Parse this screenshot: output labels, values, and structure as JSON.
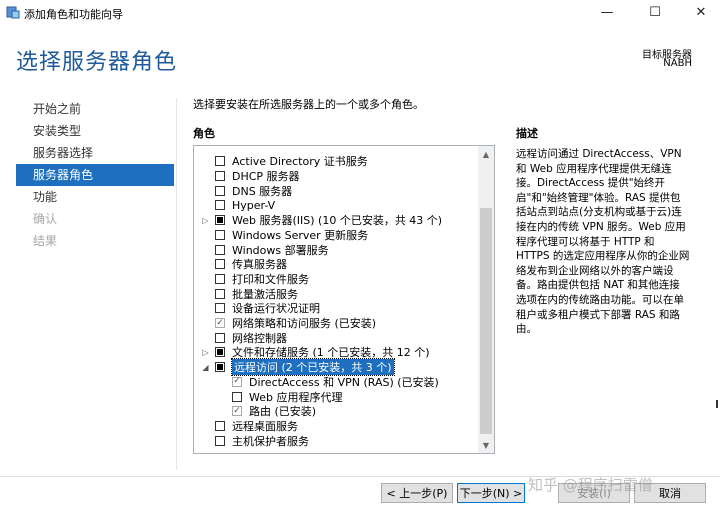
{
  "window": {
    "title": "添加角色和功能向导",
    "controls": {
      "minimize": "—",
      "maximize": "☐",
      "close": "✕"
    }
  },
  "header": {
    "title": "选择服务器角色",
    "target_label": "目标服务器",
    "target_name": "NABH"
  },
  "nav": {
    "items": [
      {
        "label": "开始之前",
        "state": "normal"
      },
      {
        "label": "安装类型",
        "state": "normal"
      },
      {
        "label": "服务器选择",
        "state": "normal"
      },
      {
        "label": "服务器角色",
        "state": "active"
      },
      {
        "label": "功能",
        "state": "normal"
      },
      {
        "label": "确认",
        "state": "disabled"
      },
      {
        "label": "结果",
        "state": "disabled"
      }
    ]
  },
  "main": {
    "instruction": "选择要安装在所选服务器上的一个或多个角色。",
    "roles_heading": "角色",
    "roles": [
      {
        "label": "Active Directory 证书服务",
        "check": "unchecked",
        "expander": "",
        "indent": 0
      },
      {
        "label": "DHCP 服务器",
        "check": "unchecked",
        "expander": "",
        "indent": 0
      },
      {
        "label": "DNS 服务器",
        "check": "unchecked",
        "expander": "",
        "indent": 0
      },
      {
        "label": "Hyper-V",
        "check": "unchecked",
        "expander": "",
        "indent": 0
      },
      {
        "label": "Web 服务器(IIS) (10 个已安装，共 43 个)",
        "check": "partial",
        "expander": "▷",
        "indent": 0
      },
      {
        "label": "Windows Server 更新服务",
        "check": "unchecked",
        "expander": "",
        "indent": 0
      },
      {
        "label": "Windows 部署服务",
        "check": "unchecked",
        "expander": "",
        "indent": 0
      },
      {
        "label": "传真服务器",
        "check": "unchecked",
        "expander": "",
        "indent": 0
      },
      {
        "label": "打印和文件服务",
        "check": "unchecked",
        "expander": "",
        "indent": 0
      },
      {
        "label": "批量激活服务",
        "check": "unchecked",
        "expander": "",
        "indent": 0
      },
      {
        "label": "设备运行状况证明",
        "check": "unchecked",
        "expander": "",
        "indent": 0
      },
      {
        "label": "网络策略和访问服务 (已安装)",
        "check": "checked",
        "expander": "",
        "indent": 0
      },
      {
        "label": "网络控制器",
        "check": "unchecked",
        "expander": "",
        "indent": 0
      },
      {
        "label": "文件和存储服务 (1 个已安装，共 12 个)",
        "check": "partial",
        "expander": "▷",
        "indent": 0
      },
      {
        "label": "远程访问 (2 个已安装，共 3 个)",
        "check": "partial",
        "expander": "◢",
        "indent": 0,
        "selected": true
      },
      {
        "label": "DirectAccess 和 VPN (RAS) (已安装)",
        "check": "checked",
        "expander": "",
        "indent": 1
      },
      {
        "label": "Web 应用程序代理",
        "check": "unchecked",
        "expander": "",
        "indent": 1
      },
      {
        "label": "路由 (已安装)",
        "check": "checked",
        "expander": "",
        "indent": 1
      },
      {
        "label": "远程桌面服务",
        "check": "unchecked",
        "expander": "",
        "indent": 0
      },
      {
        "label": "主机保护者服务",
        "check": "unchecked",
        "expander": "",
        "indent": 0
      }
    ],
    "description_heading": "描述",
    "description": "远程访问通过 DirectAccess、VPN 和 Web 应用程序代理提供无缝连接。DirectAccess 提供\"始终开启\"和\"始终管理\"体验。RAS 提供包括站点到站点(分支机构或基于云)连接在内的传统 VPN 服务。Web 应用程序代理可以将基于 HTTP 和 HTTPS 的选定应用程序从你的企业网络发布到企业网络以外的客户端设备。路由提供包括 NAT 和其他连接选项在内的传统路由功能。可以在单租户或多租户模式下部署 RAS 和路由。"
  },
  "footer": {
    "prev_label": "< 上一步(P)",
    "next_label": "下一步(N) >",
    "install_label": "安装(I)",
    "cancel_label": "取消"
  },
  "watermark": "知乎 @程序扫雷僧"
}
